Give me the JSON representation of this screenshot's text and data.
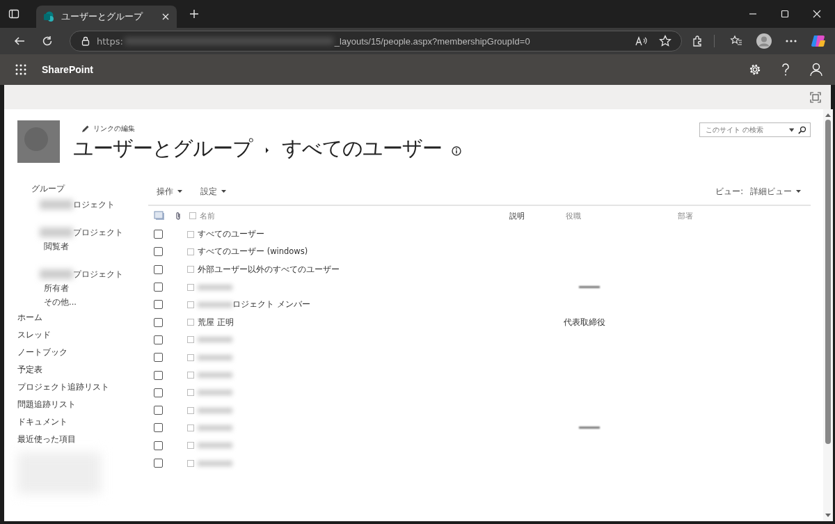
{
  "browser": {
    "tab": {
      "title": "ユーザーとグループ",
      "selected": true
    },
    "address": {
      "scheme": "https:",
      "path": "_layouts/15/people.aspx?membershipGroupId=0"
    }
  },
  "suite_bar": {
    "app_name": "SharePoint"
  },
  "page": {
    "edit_links": "リンクの編集",
    "breadcrumb": [
      "ユーザーとグループ",
      "すべてのユーザー"
    ],
    "search": {
      "placeholder": "このサイト の検索"
    }
  },
  "sidebar": {
    "heading": "グループ",
    "groups": [
      {
        "text": "ロジェクト",
        "blurred": true
      },
      {
        "text": "プロジェクト",
        "blurred": true
      },
      {
        "text": "閲覧者",
        "blurred": false
      },
      {
        "text": "プロジェクト",
        "blurred": true
      },
      {
        "text": "所有者",
        "blurred": false
      },
      {
        "text": "その他...",
        "blurred": false
      }
    ],
    "items": [
      "ホーム",
      "スレッド",
      "ノートブック",
      "予定表",
      "プロジェクト追跡リスト",
      "問題追跡リスト",
      "ドキュメント",
      "最近使った項目"
    ]
  },
  "toolbar": {
    "menus": [
      "操作",
      "設定"
    ],
    "view_label": "ビュー:",
    "view": "詳細ビュー"
  },
  "table": {
    "columns": [
      "名前",
      "説明",
      "役職",
      "部署"
    ],
    "rows": [
      {
        "name": "すべてのユーザー",
        "name_blurred": false,
        "checked": false
      },
      {
        "name": "すべてのユーザー (windows)",
        "name_blurred": false,
        "checked": false
      },
      {
        "name": "外部ユーザー以外のすべてのユーザー",
        "name_blurred": false,
        "checked": false
      },
      {
        "name_blurred": true,
        "title_blurred": true,
        "checked": false
      },
      {
        "name": "ロジェクト メンバー",
        "name_blurred": true,
        "checked": false
      },
      {
        "name": "荒屋 正明",
        "name_blurred": false,
        "title": "代表取締役",
        "checked": false
      },
      {
        "name_blurred": true,
        "checked": false
      },
      {
        "name_blurred": true,
        "checked": false
      },
      {
        "name_blurred": true,
        "checked": false
      },
      {
        "name_blurred": true,
        "checked": false
      },
      {
        "name_blurred": true,
        "checked": false
      },
      {
        "name_blurred": true,
        "title_blurred": true,
        "checked": false
      },
      {
        "name_blurred": true,
        "checked": false
      },
      {
        "name_blurred": true,
        "checked": false
      }
    ]
  }
}
